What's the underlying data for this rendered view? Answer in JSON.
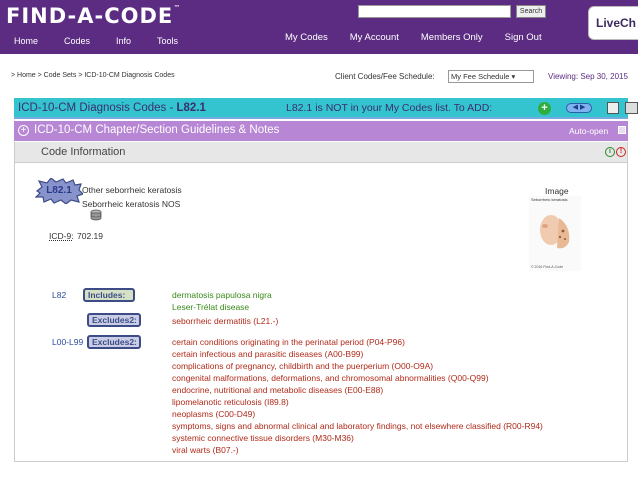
{
  "header": {
    "logo": "FIND-A-CODE",
    "logo_tm": "™",
    "search_button": "Search",
    "search_placeholder": "",
    "livechat": "LiveCh",
    "main_nav": [
      "Home",
      "Codes",
      "Info",
      "Tools"
    ],
    "right_nav": [
      "My Codes",
      "My Account",
      "Members Only",
      "Sign Out"
    ]
  },
  "breadcrumb": "> Home > Code Sets > ICD-10-CM Diagnosis Codes",
  "fee_schedule": {
    "label": "Client Codes/Fee Schedule:",
    "selected": "My Fee Schedule ▾"
  },
  "viewing": "Viewing: Sep 30, 2015",
  "code_bar": {
    "title_prefix": "ICD-10-CM Diagnosis Codes - ",
    "code": "L82.1",
    "notice": "L82.1 is NOT in your My Codes list. To ADD:",
    "add_symbol": "+"
  },
  "guidelines_bar": {
    "title": "ICD-10-CM Chapter/Section Guidelines & Notes",
    "auto_open": "Auto-open"
  },
  "code_info": {
    "header": "Code Information",
    "code": "L82.1",
    "descriptions": [
      "Other seborrheic keratosis",
      "Seborrheic keratosis NOS"
    ],
    "icd9_label": "ICD-9:",
    "icd9_value": "702.19",
    "image_label": "Image",
    "image_caption": "Seborrheic keratosis",
    "image_credit": "© 2016 Find-A-Code"
  },
  "notes": {
    "l82": {
      "code": "L82",
      "includes_label": "Includes:",
      "includes": [
        "dermatosis papulosa nigra",
        "Leser-Trélat disease"
      ],
      "excludes2_label": "Excludes2:",
      "excludes2": [
        "seborrheic dermatitis (L21.-)"
      ]
    },
    "l00": {
      "code": "L00-L99",
      "excludes2_label": "Excludes2:",
      "excludes2": [
        "certain conditions originating in the perinatal period (P04-P96)",
        "certain infectious and parasitic diseases (A00-B99)",
        "complications of pregnancy, childbirth and the puerperium (O00-O9A)",
        "congenital malformations, deformations, and chromosomal abnormalities (Q00-Q99)",
        "endocrine, nutritional and metabolic diseases (E00-E88)",
        "lipomelanotic reticulosis (I89.8)",
        "neoplasms (C00-D49)",
        "symptoms, signs and abnormal clinical and laboratory findings, not elsewhere classified (R00-R94)",
        "systemic connective tissue disorders (M30-M36)",
        "viral warts (B07.-)"
      ]
    }
  },
  "colors": {
    "header_bg": "#5b2c82",
    "code_bar": "#33c4cf",
    "guidelines_bar": "#b786d4",
    "includes_text": "#3a8a1a",
    "excludes_text": "#b02a1a"
  }
}
